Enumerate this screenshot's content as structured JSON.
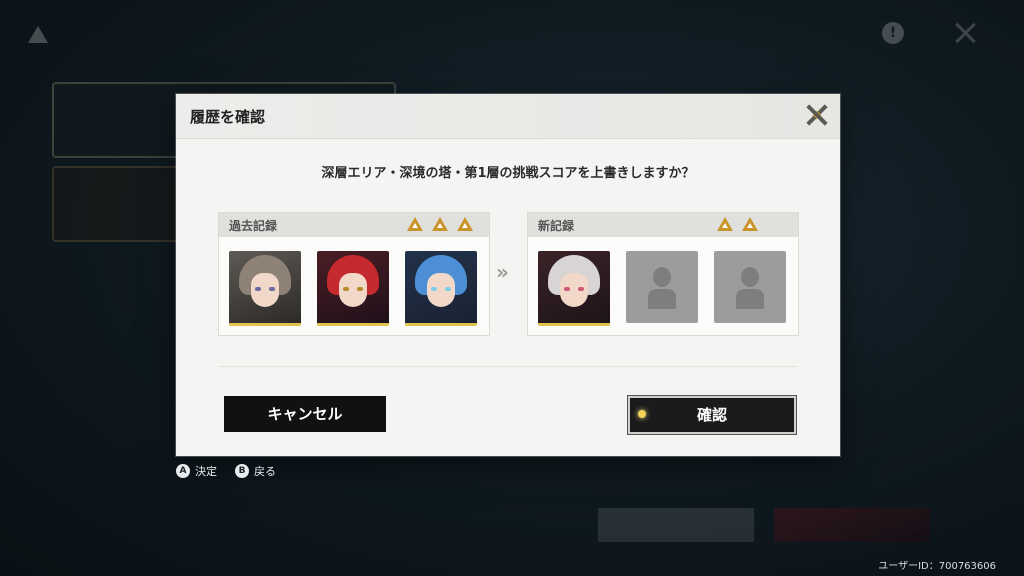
{
  "modal": {
    "title": "履歴を確認",
    "question": "深層エリア・深境の塔・第1層の挑戦スコアを上書きしますか？",
    "past_record": {
      "label": "過去記録",
      "stars": 3,
      "members": [
        "character-1",
        "character-2",
        "character-3"
      ]
    },
    "new_record": {
      "label": "新記録",
      "stars": 2,
      "members": [
        "character-4",
        "empty",
        "empty"
      ]
    },
    "arrow": "»",
    "cancel_label": "キャンセル",
    "confirm_label": "確認"
  },
  "hints": [
    {
      "key": "A",
      "label": "決定"
    },
    {
      "key": "B",
      "label": "戻る"
    }
  ],
  "user_id": "ユーザーID：700763606",
  "colors": {
    "accent_gold": "#c9942a",
    "button_dark": "#111111",
    "modal_bg": "#f4f4f3"
  }
}
